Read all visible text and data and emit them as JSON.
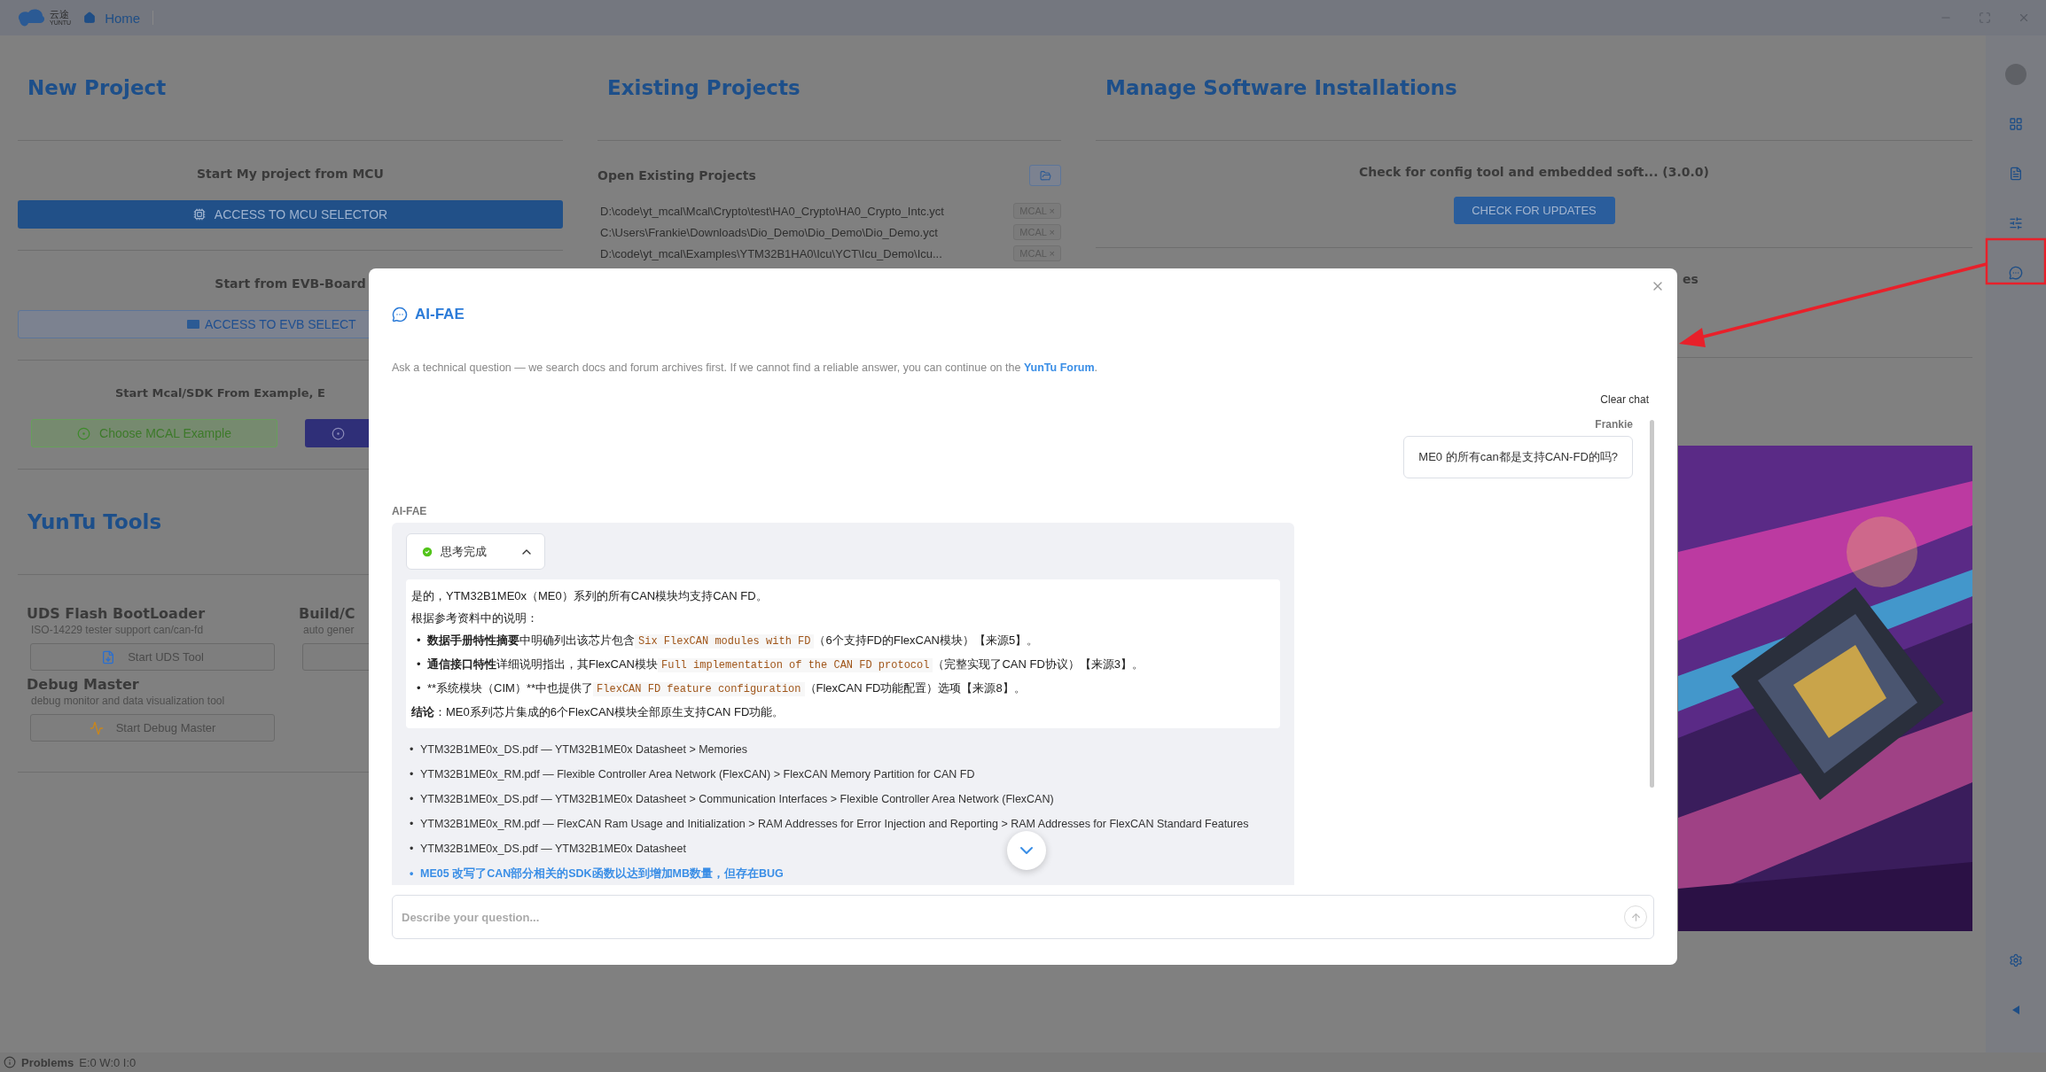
{
  "title_bar": {
    "logo_text": "云途",
    "logo_sub": "YUNTU",
    "tab": "Home"
  },
  "new_project": {
    "title": "New Project",
    "mcu_heading": "Start My project from MCU",
    "mcu_button": "ACCESS TO MCU SELECTOR",
    "evb_heading": "Start from EVB-Board",
    "evb_button": "ACCESS TO EVB SELECT",
    "example_heading": "Start Mcal/SDK From Example, E",
    "example_button": "Choose MCAL Example"
  },
  "tools": {
    "title": "YunTu Tools",
    "items": [
      {
        "kind": "uds",
        "name": "UDS Flash BootLoader",
        "desc": "ISO-14229 tester support can/can-fd",
        "button": "Start UDS Tool"
      },
      {
        "kind": "build",
        "name": "Build/C",
        "desc": "auto gener"
      },
      {
        "kind": "debug",
        "name": "Debug Master",
        "desc": "debug monitor and data visualization tool",
        "button": "Start Debug Master"
      }
    ]
  },
  "existing": {
    "title": "Existing Projects",
    "heading": "Open Existing Projects",
    "projects": [
      {
        "path": "D:\\code\\yt_mcal\\Mcal\\Crypto\\test\\HA0_Crypto\\HA0_Crypto_Intc.yct",
        "tag": "MCAL ×"
      },
      {
        "path": "C:\\Users\\Frankie\\Downloads\\Dio_Demo\\Dio_Demo\\Dio_Demo.yct",
        "tag": "MCAL ×"
      },
      {
        "path": "D:\\code\\yt_mcal\\Examples\\YTM32B1HA0\\Icu\\YCT\\Icu_Demo\\Icu...",
        "tag": "MCAL ×"
      }
    ]
  },
  "manage": {
    "title": "Manage Software Installations",
    "check_heading": "Check for config tool and embedded soft... (3.0.0)",
    "check_button": "CHECK FOR UPDATES",
    "second_heading": "es"
  },
  "status_bar": {
    "label": "Problems",
    "counts": "E:0 W:0 I:0"
  },
  "sidebar": {
    "items": [
      {
        "kind": "avatar"
      },
      {
        "kind": "grid"
      },
      {
        "kind": "document"
      },
      {
        "kind": "sliders"
      },
      {
        "kind": "chat"
      }
    ],
    "bottom": [
      {
        "kind": "settings"
      },
      {
        "kind": "collapse"
      }
    ]
  },
  "modal": {
    "title": "AI-FAE",
    "intro": "Ask a technical question — we search docs and forum archives first. If we cannot find a reliable answer, you can continue on the",
    "intro_link": "YunTu Forum",
    "intro_end": ".",
    "clear": "Clear chat",
    "user": {
      "name": "Frankie",
      "message": "ME0 的所有can都是支持CAN-FD的吗?"
    },
    "bot": {
      "name": "AI-FAE",
      "status": "思考完成",
      "expanded": true,
      "lines": [
        {
          "kind": "para",
          "parts": [
            {
              "kind": "text",
              "text": "是的，YTM32B1ME0x（ME0）系列的所有CAN模块均支持CAN FD。"
            }
          ]
        },
        {
          "kind": "para",
          "parts": [
            {
              "kind": "text",
              "text": "根据参考资料中的说明："
            }
          ]
        },
        {
          "kind": "bullet",
          "marker": "•",
          "parts": [
            {
              "kind": "bold",
              "text": "数据手册特性摘要"
            },
            {
              "kind": "text",
              "text": "中明确列出该芯片包含"
            },
            {
              "kind": "code",
              "text": "Six FlexCAN modules with FD"
            },
            {
              "kind": "text",
              "text": "（6个支持FD的FlexCAN模块）【来源5】。"
            }
          ]
        },
        {
          "kind": "bullet",
          "marker": "•",
          "parts": [
            {
              "kind": "bold",
              "text": "通信接口特性"
            },
            {
              "kind": "text",
              "text": "详细说明指出，其FlexCAN模块"
            },
            {
              "kind": "code",
              "text": "Full implementation of the CAN FD protocol"
            },
            {
              "kind": "text",
              "text": "（完整实现了CAN FD协议）【来源3】。"
            }
          ]
        },
        {
          "kind": "bullet",
          "marker": "•",
          "parts": [
            {
              "kind": "text",
              "text": "**系统模块（CIM）**中也提供了"
            },
            {
              "kind": "code",
              "text": "FlexCAN FD feature configuration"
            },
            {
              "kind": "text",
              "text": "（FlexCAN FD功能配置）选项【来源8】。"
            }
          ]
        },
        {
          "kind": "para",
          "parts": [
            {
              "kind": "bold",
              "text": "结论"
            },
            {
              "kind": "text",
              "text": "：ME0系列芯片集成的6个FlexCAN模块全部原生支持CAN FD功能。"
            }
          ]
        }
      ],
      "sources": [
        {
          "kind": "doc",
          "marker": "•",
          "text": "YTM32B1ME0x_DS.pdf — YTM32B1ME0x Datasheet > Memories"
        },
        {
          "kind": "doc",
          "marker": "•",
          "text": "YTM32B1ME0x_RM.pdf — Flexible Controller Area Network (FlexCAN) > FlexCAN Memory Partition for CAN FD"
        },
        {
          "kind": "doc",
          "marker": "•",
          "text": "YTM32B1ME0x_DS.pdf — YTM32B1ME0x Datasheet > Communication Interfaces > Flexible Controller Area Network (FlexCAN)"
        },
        {
          "kind": "doc",
          "marker": "•",
          "text": "YTM32B1ME0x_RM.pdf — FlexCAN Ram Usage and Initialization > RAM Addresses for Error Injection and Reporting > RAM Addresses for FlexCAN Standard Features"
        },
        {
          "kind": "doc",
          "marker": "•",
          "text": "YTM32B1ME0x_DS.pdf — YTM32B1ME0x Datasheet"
        },
        {
          "kind": "link",
          "marker": "•",
          "text": "ME05 改写了CAN部分相关的SDK函数以达到增加MB数量，但存在BUG"
        }
      ]
    },
    "input": {
      "placeholder": "Describe your question..."
    }
  }
}
